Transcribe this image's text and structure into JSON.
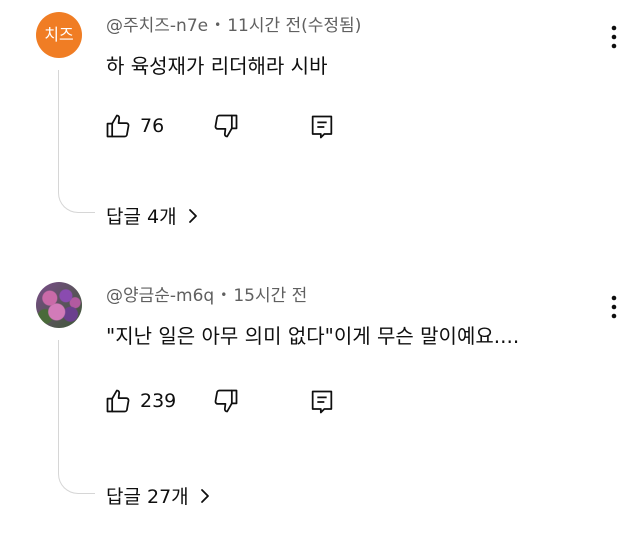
{
  "comments": [
    {
      "avatar_text": "치즈",
      "author": "@주치즈-n7e",
      "separator": "•",
      "time": "11시간 전(수정됨)",
      "text": "하 육성재가 리더해라 시바",
      "likes": "76",
      "replies_label": "답글 4개"
    },
    {
      "author": "@양금순-m6q",
      "separator": "•",
      "time": "15시간 전",
      "text": "\"지난 일은 아무 의미 없다\"이게 무슨 말이예요....",
      "likes": "239",
      "replies_label": "답글 27개"
    }
  ],
  "icons": {
    "like": "thumbs-up-icon",
    "dislike": "thumbs-down-icon",
    "reply": "reply-comment-icon",
    "more": "more-vertical-icon",
    "chevron": "chevron-right-icon"
  },
  "colors": {
    "avatar_bg": "#f07d24",
    "meta_text": "#606060",
    "thread_line": "#d6d6d6"
  }
}
